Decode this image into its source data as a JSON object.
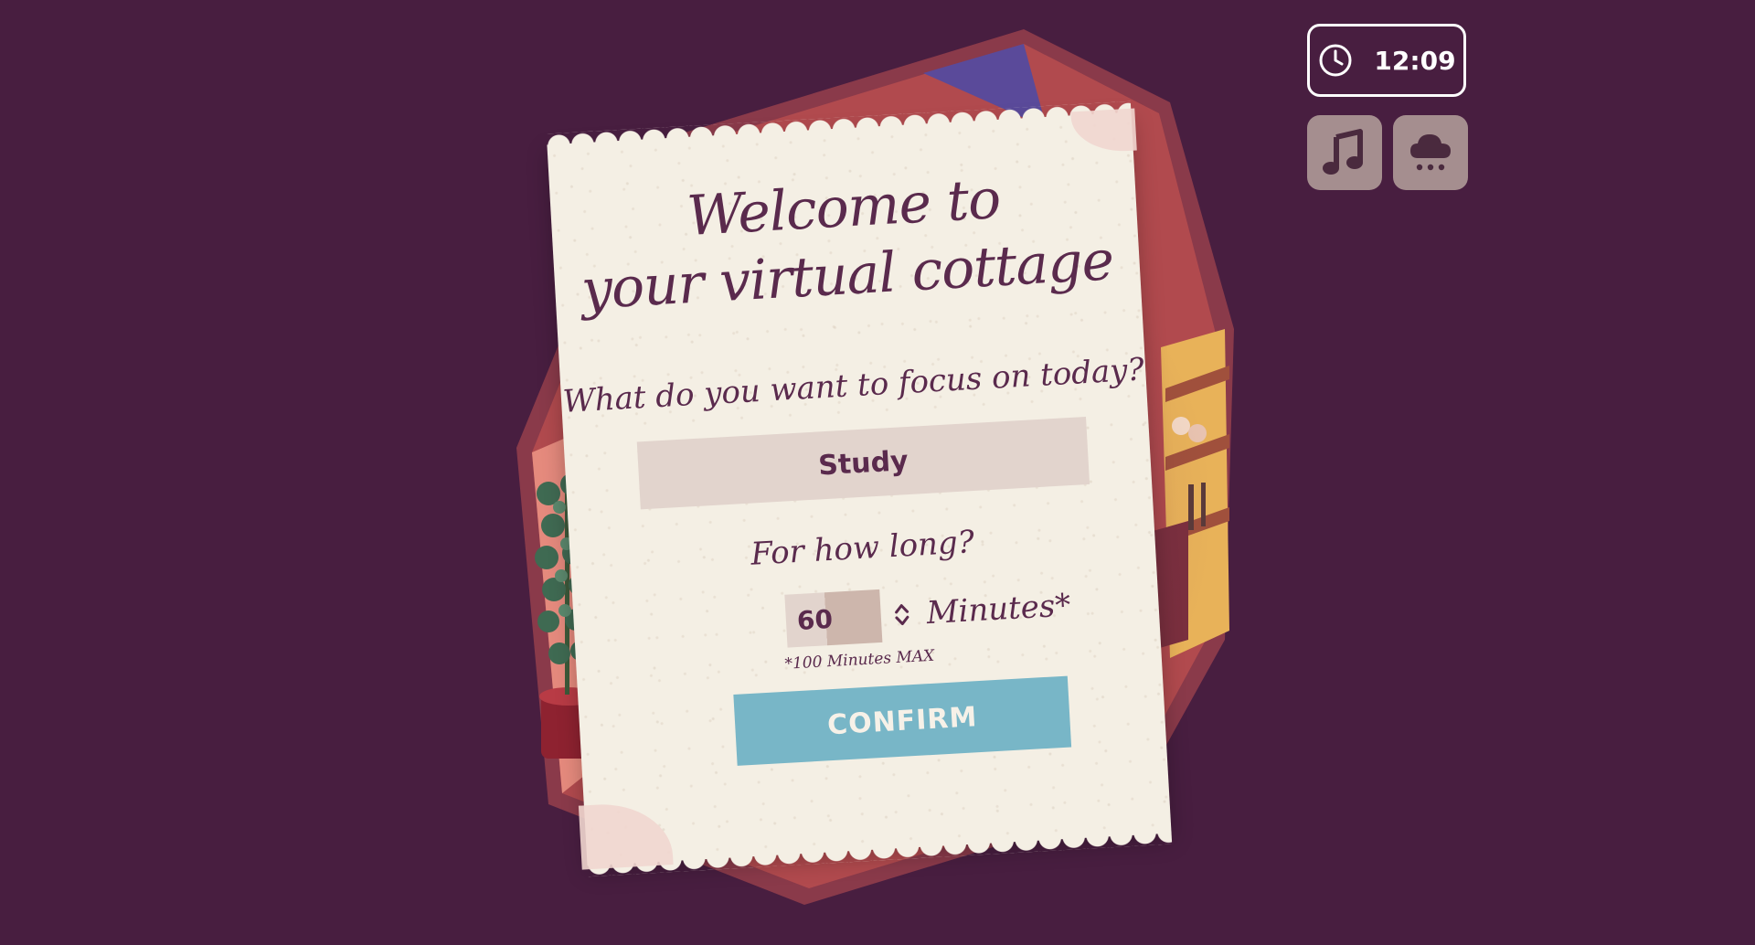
{
  "welcome": {
    "title_line1": "Welcome to",
    "title_line2": "your virtual cottage",
    "focus_question": "What do you want to focus on today?",
    "focus_value": "Study",
    "duration_question": "For how long?",
    "duration_value": "60",
    "duration_unit": "Minutes*",
    "duration_note": "*100 Minutes MAX",
    "confirm_label": "CONFIRM"
  },
  "hud": {
    "clock_time": "12:09",
    "clock_icon": "clock-icon",
    "music_icon": "music-note-icon",
    "weather_icon": "rain-cloud-icon"
  },
  "colors": {
    "background": "#481e40",
    "paper": "#f4efe4",
    "text": "#5a2a4d",
    "input": "#e2d4cd",
    "confirm": "#78b6c7",
    "hud_button": "#a58e8f"
  }
}
